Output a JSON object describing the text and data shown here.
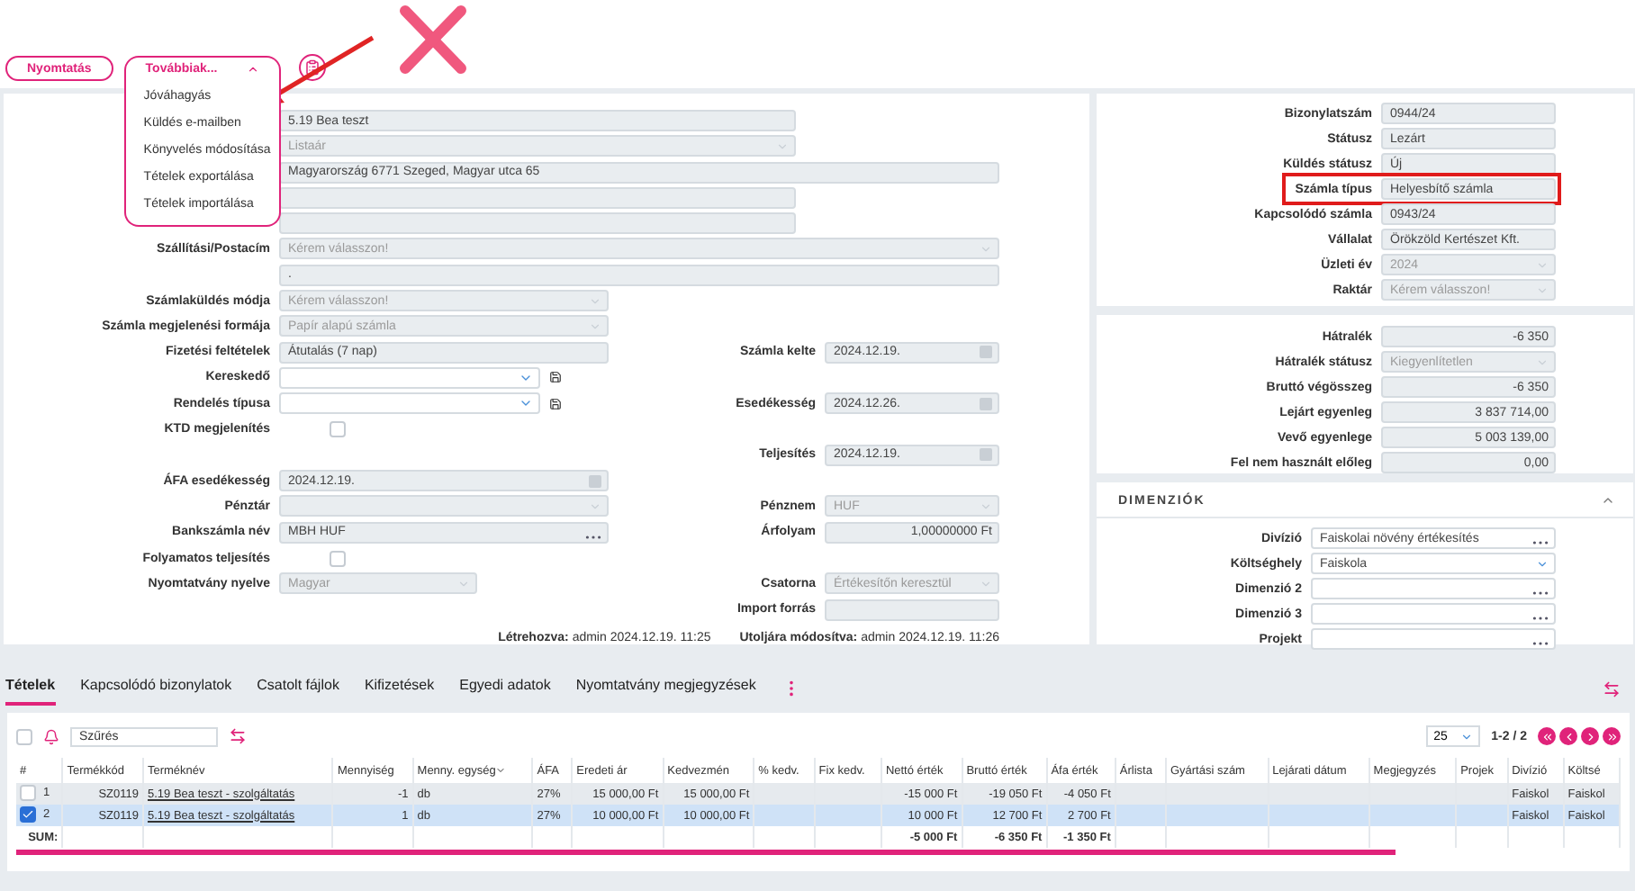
{
  "toolbar": {
    "print_button": "Nyomtatás",
    "more_button": {
      "label": "Továbbiak...",
      "expanded": true
    },
    "more_menu": [
      "Jóváhagyás",
      "Küldés e-mailben",
      "Könyvelés módosítása",
      "Tételek exportálása",
      "Tételek importálása"
    ]
  },
  "form": {
    "rows": [
      {
        "left": {
          "kind": "text",
          "value": "5.19 Bea teszt"
        }
      },
      {
        "left": {
          "kind": "select",
          "value": "Listaár"
        }
      },
      {
        "left": {
          "kind": "text",
          "value": "Magyarország 6771 Szeged, Magyar utca 65"
        }
      },
      {
        "left": {
          "kind": "text"
        }
      },
      {
        "left": {
          "kind": "text"
        }
      },
      {
        "left": {
          "label": "Szállítási/Postacím",
          "kind": "select",
          "placeholder": "Kérem válasszon!"
        }
      },
      {
        "left": {
          "kind": "text",
          "value": "."
        }
      },
      {
        "left": {
          "label": "Számlaküldés módja",
          "kind": "select",
          "placeholder": "Kérem válasszon!"
        }
      },
      {
        "left": {
          "label": "Számla megjelenési formája",
          "kind": "select",
          "value": "Papír alapú számla"
        }
      },
      {
        "left": {
          "label": "Fizetési feltételek",
          "kind": "text",
          "value": "Átutalás (7 nap)"
        },
        "right": {
          "label": "Számla kelte",
          "kind": "date",
          "value": "2024.12.19."
        }
      },
      {
        "left": {
          "label": "Kereskedő",
          "kind": "picker"
        }
      },
      {
        "left": {
          "label": "Rendelés típusa",
          "kind": "picker"
        },
        "right": {
          "label": "Esedékesség",
          "kind": "date",
          "value": "2024.12.26."
        }
      },
      {
        "left": {
          "label": "KTD megjelenítés",
          "kind": "checkbox",
          "checked": false
        }
      },
      {
        "right": {
          "label": "Teljesítés",
          "kind": "date",
          "value": "2024.12.19."
        }
      },
      {
        "left": {
          "label": "ÁFA esedékesség",
          "kind": "date",
          "value": "2024.12.19."
        }
      },
      {
        "left": {
          "label": "Pénztár",
          "kind": "select"
        },
        "right": {
          "label": "Pénznem",
          "kind": "select",
          "value": "HUF"
        }
      },
      {
        "left": {
          "label": "Bankszámla név",
          "kind": "lookup",
          "value": "MBH HUF"
        },
        "right": {
          "label": "Árfolyam",
          "kind": "number",
          "value": "1,00000000 Ft"
        }
      },
      {
        "left": {
          "label": "Folyamatos teljesítés",
          "kind": "checkbox",
          "checked": false
        }
      },
      {
        "left": {
          "label": "Nyomtatvány nyelve",
          "kind": "select",
          "value": "Magyar"
        },
        "right": {
          "label": "Csatorna",
          "kind": "select",
          "value": "Értékesítőn keresztül"
        }
      },
      {
        "right": {
          "label": "Import forrás",
          "kind": "text"
        }
      }
    ],
    "created": {
      "label": "Létrehozva:",
      "value": "admin 2024.12.19. 11:25"
    },
    "modified": {
      "label": "Utoljára módosítva:",
      "value": "admin 2024.12.19. 11:26"
    }
  },
  "document_panel": {
    "rows": [
      {
        "label": "Bizonylatszám",
        "kind": "text",
        "value": "0944/24",
        "highlighted": false
      },
      {
        "label": "Státusz",
        "kind": "text",
        "value": "Lezárt",
        "highlighted": false
      },
      {
        "label": "Küldés státusz",
        "kind": "text",
        "value": "Új",
        "highlighted": false
      },
      {
        "label": "Számla típus",
        "kind": "text",
        "value": "Helyesbítő számla",
        "highlighted": true
      },
      {
        "label": "Kapcsolódó számla",
        "kind": "text",
        "value": "0943/24",
        "highlighted": false
      },
      {
        "label": "Vállalat",
        "kind": "text",
        "value": "Örökzöld  Kertészet Kft.",
        "highlighted": false
      },
      {
        "label": "Üzleti év",
        "kind": "select",
        "value": "2024",
        "highlighted": false
      },
      {
        "label": "Raktár",
        "kind": "select",
        "placeholder": "Kérem válasszon!",
        "highlighted": false
      }
    ]
  },
  "balance_panel": {
    "rows": [
      {
        "label": "Hátralék",
        "kind": "number",
        "value": "-6 350"
      },
      {
        "label": "Hátralék státusz",
        "kind": "select",
        "value": "Kiegyenlítetlen"
      },
      {
        "label": "Bruttó végösszeg",
        "kind": "number",
        "value": "-6 350"
      },
      {
        "label": "Lejárt egyenleg",
        "kind": "number",
        "value": "3 837 714,00"
      },
      {
        "label": "Vevő egyenlege",
        "kind": "number",
        "value": "5 003 139,00"
      },
      {
        "label": "Fel nem használt előleg",
        "kind": "number",
        "value": "0,00"
      }
    ]
  },
  "dimensions": {
    "title": "DIMENZIÓK",
    "expanded": true,
    "rows": [
      {
        "label": "Divízió",
        "kind": "lookup",
        "value": "Faiskolai növény értékesítés"
      },
      {
        "label": "Költséghely",
        "kind": "select",
        "value": "Faiskola"
      },
      {
        "label": "Dimenzió 2",
        "kind": "lookup"
      },
      {
        "label": "Dimenzió 3",
        "kind": "lookup"
      },
      {
        "label": "Projekt",
        "kind": "lookup"
      }
    ]
  },
  "tabs": [
    {
      "label": "Tételek",
      "selected": true
    },
    {
      "label": "Kapcsolódó bizonylatok",
      "selected": false
    },
    {
      "label": "Csatolt fájlok",
      "selected": false
    },
    {
      "label": "Kifizetések",
      "selected": false
    },
    {
      "label": "Egyedi adatok",
      "selected": false
    },
    {
      "label": "Nyomtatvány megjegyzések",
      "selected": false
    }
  ],
  "items_table": {
    "select_all": {
      "checked": false
    },
    "filter": {
      "placeholder": "Szűrés"
    },
    "page_size": "25",
    "page_info": "1-2 / 2",
    "columns": [
      "#",
      "Termékkód",
      "Terméknév",
      "Mennyiség",
      "Menny. egység",
      "ÁFA",
      "Eredeti ár",
      "Kedvezmén",
      "% kedv.",
      "Fix kedv.",
      "Nettó érték",
      "Bruttó érték",
      "Áfa érték",
      "Árlista",
      "Gyártási szám",
      "Lejárati dátum",
      "Megjegyzés",
      "Projek",
      "Divízió",
      "Költsé"
    ],
    "rows": [
      {
        "selected": false,
        "cells": [
          "1",
          "SZ0119",
          "5.19 Bea teszt - szolgáltatás",
          "-1",
          "db",
          "27%",
          "15 000,00 Ft",
          "15 000,00 Ft",
          null,
          null,
          "-15 000 Ft",
          "-19 050 Ft",
          "-4 050 Ft",
          null,
          null,
          null,
          null,
          null,
          "Faiskol",
          "Faiskol"
        ]
      },
      {
        "selected": true,
        "cells": [
          "2",
          "SZ0119",
          "5.19 Bea teszt - szolgáltatás",
          "1",
          "db",
          "27%",
          "10 000,00 Ft",
          "10 000,00 Ft",
          null,
          null,
          "10 000 Ft",
          "12 700 Ft",
          "2 700 Ft",
          null,
          null,
          null,
          null,
          null,
          "Faiskol",
          "Faiskol"
        ]
      }
    ],
    "sum_row": {
      "cells": [
        "SUM:",
        null,
        null,
        null,
        null,
        null,
        null,
        null,
        null,
        null,
        "-5 000 Ft",
        "-6 350 Ft",
        "-1 350 Ft",
        null,
        null,
        null,
        null,
        null,
        null,
        null
      ]
    }
  }
}
